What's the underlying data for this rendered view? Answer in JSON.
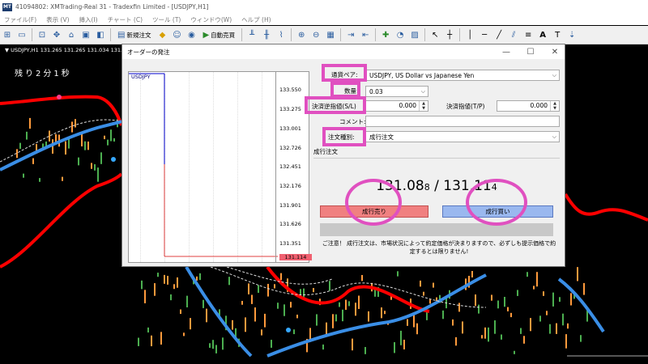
{
  "window": {
    "title": "41094802: XMTrading-Real 31 - Tradexfin Limited - [USDJPY,H1]"
  },
  "menu": [
    "ファイル(F)",
    "表示 (V)",
    "挿入(I)",
    "チャート (C)",
    "ツール (T)",
    "ウィンドウ(W)",
    "ヘルプ (H)"
  ],
  "toolbar": {
    "new_order_label": "新規注文",
    "autotrade_label": "自動売買"
  },
  "chart": {
    "label": "▼ USDJPY,H1  131.265 131.265 131.034 131.114",
    "timer": "残り2分1秒",
    "colors": {
      "band": "#ff0000",
      "ma": "#3a8ee6",
      "up_candle": "#4caf50",
      "down_candle": "#ff9a3c",
      "marker_pink": "#ff3d8a",
      "marker_blue": "#36a8ff"
    }
  },
  "dialog": {
    "title": "オーダーの発注",
    "mini_chart": {
      "symbol": "USDJPY",
      "price_levels": [
        "133.550",
        "133.275",
        "133.001",
        "132.726",
        "132.451",
        "132.176",
        "131.901",
        "131.626",
        "131.351"
      ],
      "current_price": "131.114"
    },
    "symbol_label": "通貨ペア:",
    "symbol_value": "USDJPY, US Dollar vs Japanese Yen",
    "volume_label": "数量:",
    "volume_value": "0.03",
    "sl_label": "決済逆指値(S/L)",
    "sl_value": "0.000",
    "tp_label": "決済指値(T/P)",
    "tp_value": "0.000",
    "comment_label": "コメント:",
    "comment_value": "",
    "type_label": "注文種別:",
    "type_value": "成行注文",
    "exec_section_label": "成行注文",
    "bid_main": "131.08",
    "bid_small": "8",
    "separator": " / ",
    "ask_main": "131.11",
    "ask_small": "4",
    "sell_button": "成行売り",
    "buy_button": "成行買い",
    "note": "ご注意！ 成行注文は、市場状況によって約定価格が決まりますので、必ずしも提示価格で約定するとは限りません!"
  },
  "highlight_color": "#e050c0"
}
